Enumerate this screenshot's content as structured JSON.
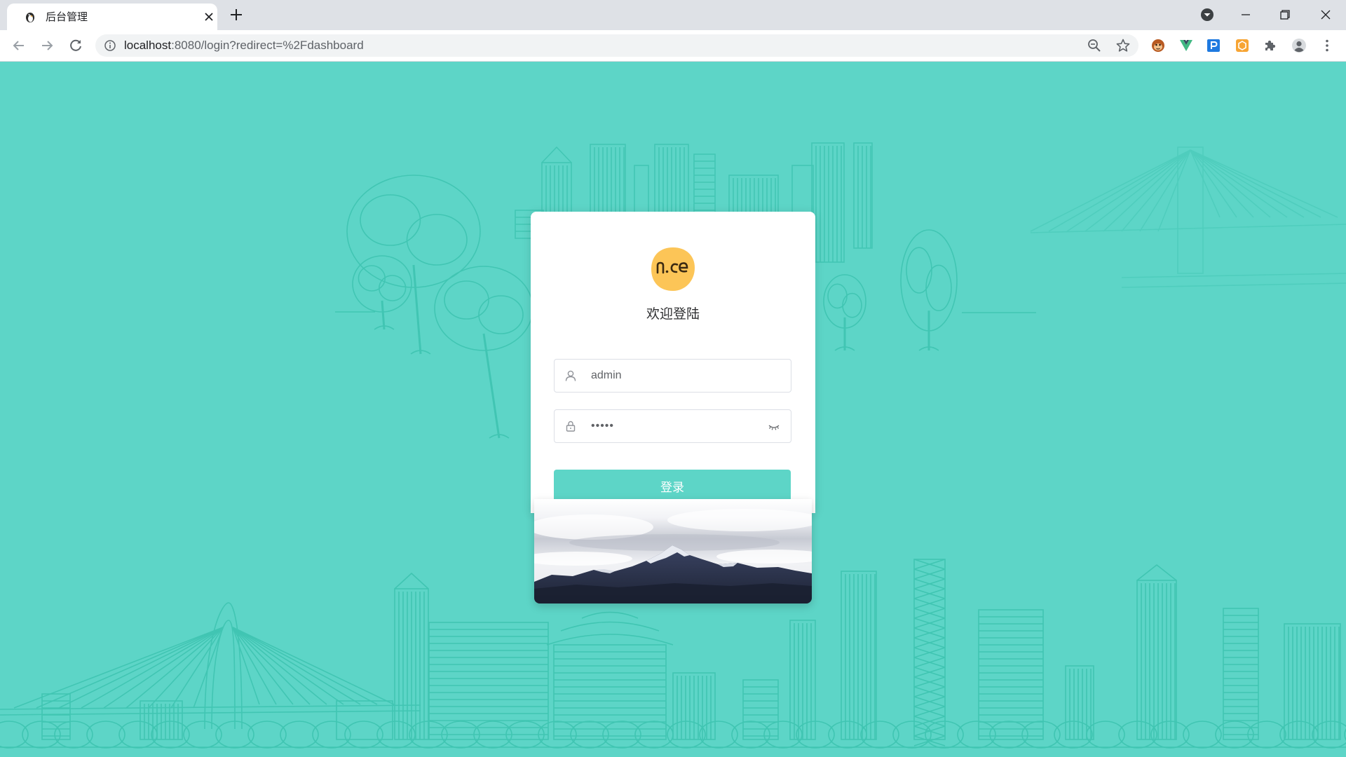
{
  "browser": {
    "tab": {
      "title": "后台管理",
      "favicon_icon": "penguin-favicon-icon",
      "close_icon": "close-icon"
    },
    "new_tab_icon": "plus-icon",
    "window_controls": {
      "tab_search_icon": "chevron-down-circle-icon",
      "minimize_icon": "minimize-icon",
      "restore_icon": "restore-icon",
      "close_icon": "close-icon"
    },
    "nav": {
      "back_icon": "arrow-left-icon",
      "forward_icon": "arrow-right-icon",
      "reload_icon": "reload-icon"
    },
    "address_bar": {
      "info_icon": "info-icon",
      "url_host": "localhost",
      "url_rest": ":8080/login?redirect=%2Fdashboard",
      "zoom_icon": "zoom-out-icon",
      "bookmark_icon": "star-icon"
    },
    "extensions": [
      "monkey-extension-icon",
      "vue-devtools-icon",
      "p-extension-icon",
      "orange-extension-icon",
      "puzzle-icon",
      "profile-avatar-icon",
      "kebab-menu-icon"
    ]
  },
  "login": {
    "logo_text": "nice",
    "welcome_text": "欢迎登陆",
    "username": {
      "icon": "user-icon",
      "value": "admin"
    },
    "password": {
      "icon": "lock-icon",
      "masked_value": "•••••",
      "toggle_icon": "eye-closed-icon"
    },
    "submit_label": "登录"
  },
  "colors": {
    "page_background": "#5dd5c7",
    "accent": "#5dd5c7",
    "logo": "#fcc557",
    "tab_strip": "#dee1e6",
    "omnibox": "#f1f3f4"
  }
}
